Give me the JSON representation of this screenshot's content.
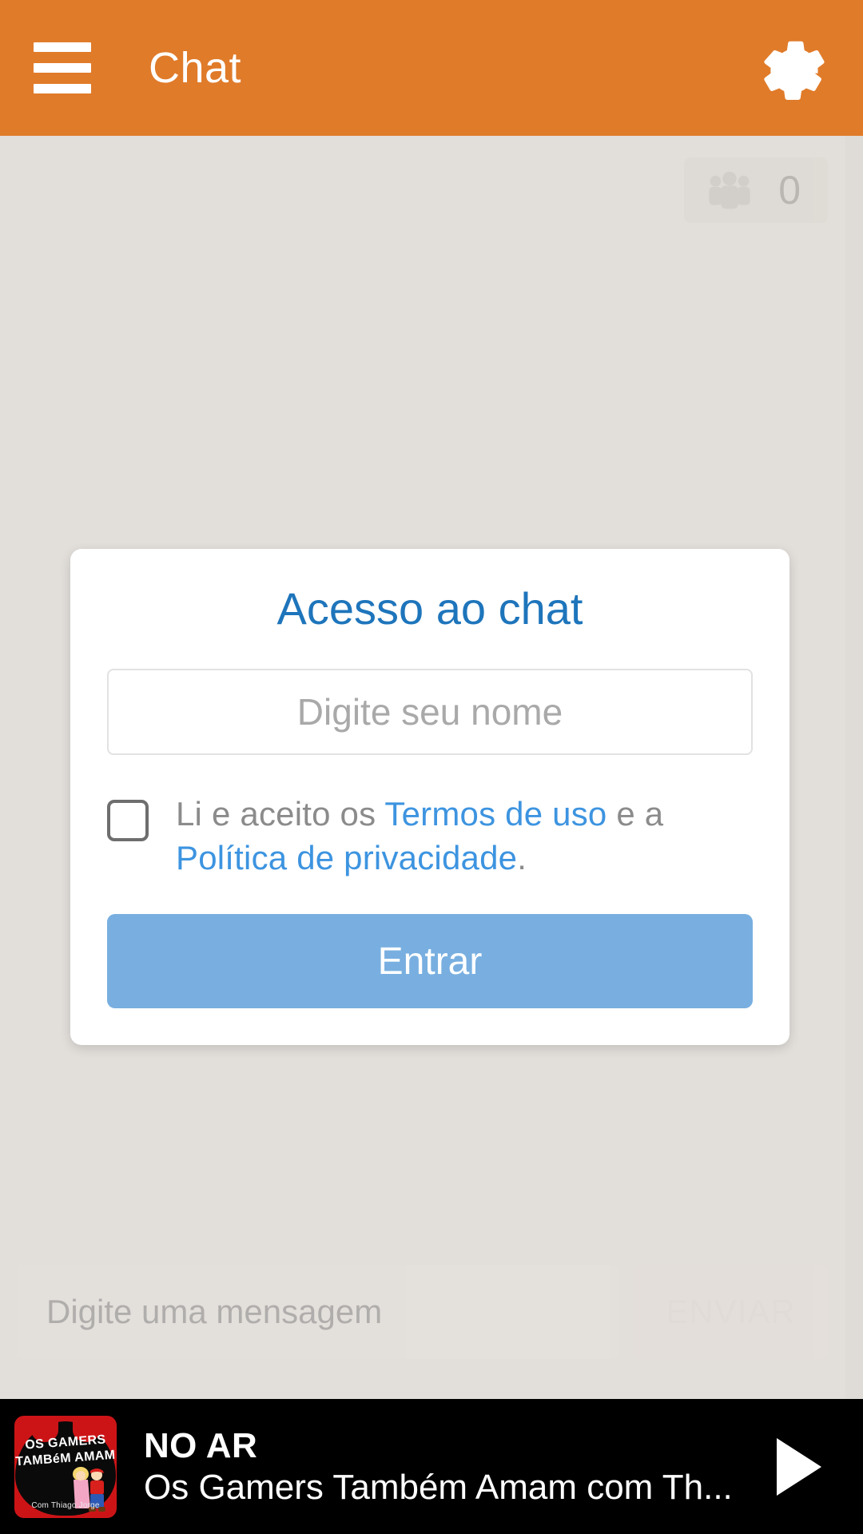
{
  "header": {
    "title": "Chat",
    "menu_icon": "hamburger-menu-icon",
    "settings_icon": "gear-icon",
    "background_color": "#E07B2A"
  },
  "chat": {
    "people_icon": "people-group-icon",
    "people_count": "0",
    "message_placeholder": "Digite uma mensagem",
    "send_label": "ENVIAR"
  },
  "modal": {
    "title": "Acesso ao chat",
    "name_placeholder": "Digite seu nome",
    "name_value": "",
    "terms": {
      "prefix": "Li e aceito os ",
      "link_terms": "Termos de uso",
      "middle": " e a ",
      "link_privacy": "Política de privacidade",
      "suffix": "."
    },
    "checkbox_checked": false,
    "submit_label": "Entrar",
    "title_color": "#1E75BB",
    "link_color": "#3D94E0",
    "button_color": "#78AFE0"
  },
  "player": {
    "status": "NO AR",
    "title": "Os Gamers Também Amam com Th...",
    "play_icon": "play-triangle-icon",
    "artwork": {
      "line1": "OS GAMERS",
      "line2": "TAMBéM AMAM",
      "credit": "Com  Thiago Jorge",
      "background_color": "#CC1417"
    }
  }
}
